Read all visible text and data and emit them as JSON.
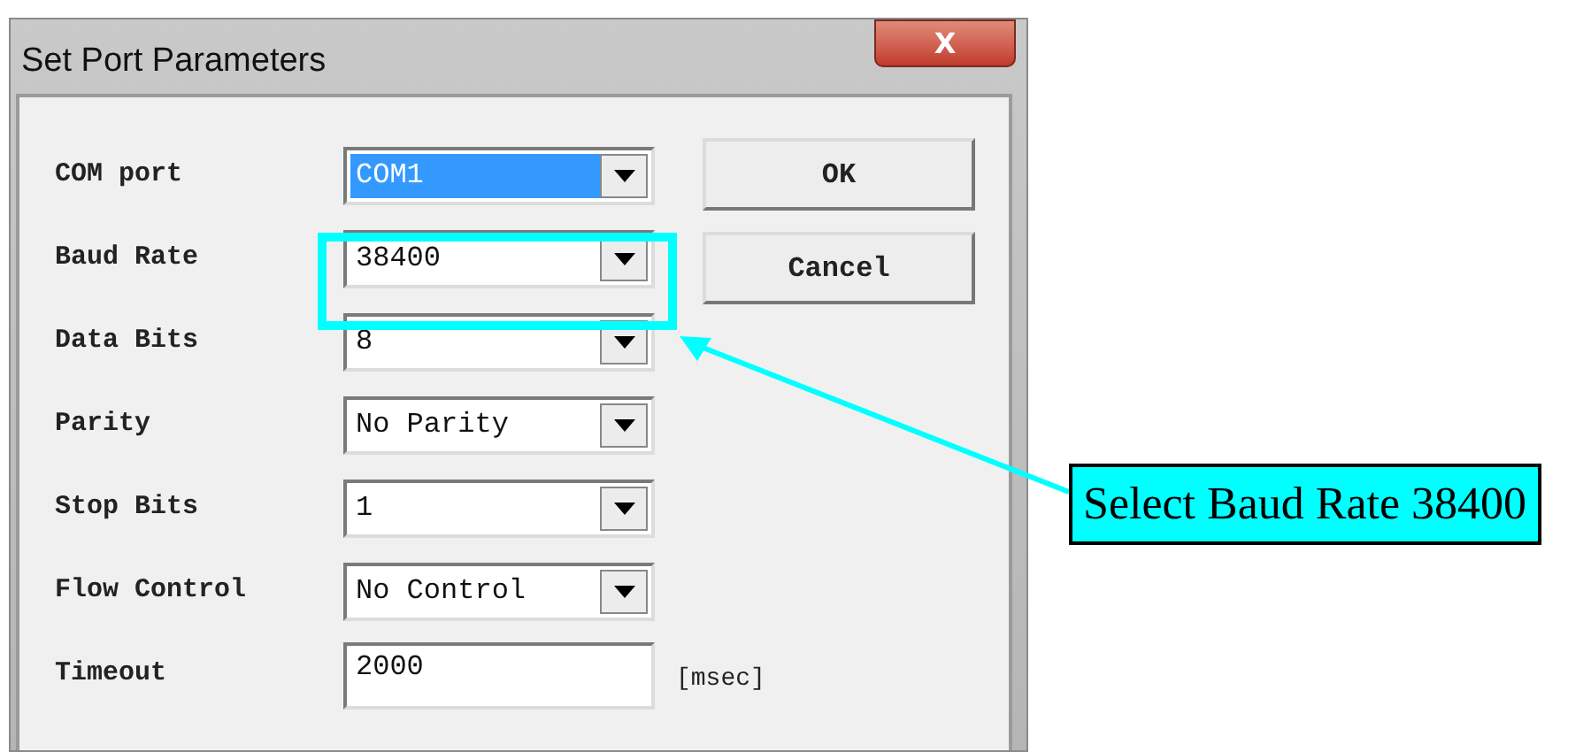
{
  "window": {
    "title": "Set Port Parameters",
    "close": "X"
  },
  "fields": [
    {
      "kind": "combo",
      "label": "COM port",
      "value": "COM1",
      "selected": true
    },
    {
      "kind": "combo",
      "label": "Baud Rate",
      "value": "38400",
      "selected": false
    },
    {
      "kind": "combo",
      "label": "Data Bits",
      "value": "8",
      "selected": false
    },
    {
      "kind": "combo",
      "label": "Parity",
      "value": "No Parity",
      "selected": false
    },
    {
      "kind": "combo",
      "label": "Stop Bits",
      "value": "1",
      "selected": false
    },
    {
      "kind": "combo",
      "label": "Flow Control",
      "value": "No Control",
      "selected": false
    },
    {
      "kind": "text",
      "label": "Timeout",
      "value": "2000",
      "unit": "[msec]"
    }
  ],
  "buttons": [
    "OK",
    "Cancel"
  ],
  "annotation": {
    "text": "Select Baud Rate 38400"
  }
}
